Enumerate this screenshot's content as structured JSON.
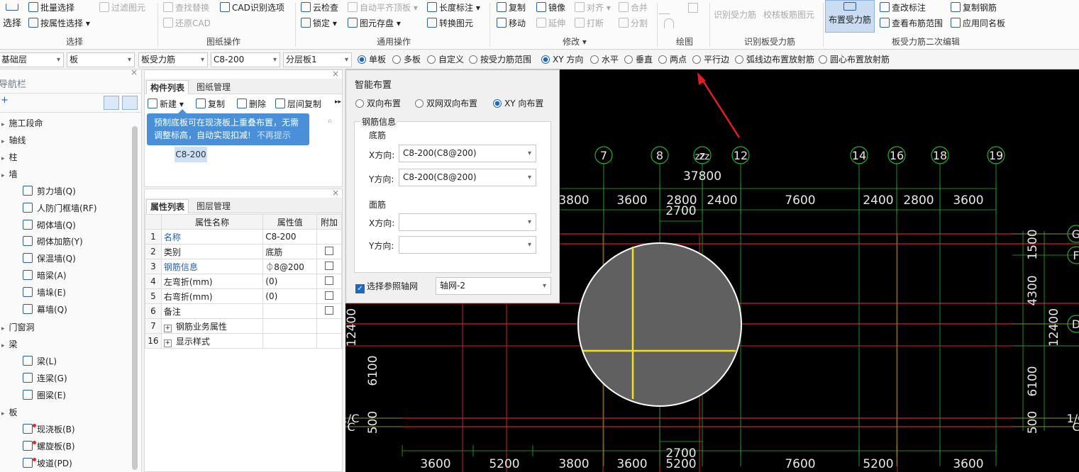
{
  "ribbon": {
    "select_btn": "选择",
    "batch_select": "批量选择",
    "by_attr_select": "按属性选择",
    "filter_element": "过滤图元",
    "find_replace": "查找替换",
    "cad_recognize_options": "CAD识别选项",
    "restore_cad": "还原CAD",
    "cloud_check": "云检查",
    "auto_align_slab": "自动平齐顶板",
    "length_dim": "长度标注",
    "lock": "锁定",
    "element_save": "图元存盘",
    "convert_element": "转换图元",
    "copy": "复制",
    "mirror": "镜像",
    "align": "对齐",
    "merge": "合并",
    "move": "移动",
    "extend": "延伸",
    "break": "打断",
    "split": "分割",
    "recognize_rebar": "识别受力筋",
    "verify_slab": "校核板筋图元",
    "place_rebar": "布置受力筋",
    "check_label": "查改标注",
    "view_range": "查看布筋范围",
    "copy_rebar": "复制钢筋",
    "apply_same_name": "应用同名板",
    "groups": {
      "select": "选择",
      "drawing_ops": "图纸操作",
      "common_ops": "通用操作",
      "modify": "修改",
      "draw": "绘图",
      "recognize": "识别板受力筋",
      "edit2": "板受力筋二次编辑"
    }
  },
  "options_bar": {
    "floor": "基础层",
    "category": "板",
    "type": "板受力筋",
    "element": "C8-200",
    "layer": "分层板1",
    "radios": [
      {
        "label": "单板",
        "checked": true
      },
      {
        "label": "多板",
        "checked": false
      },
      {
        "label": "自定义",
        "checked": false
      },
      {
        "label": "按受力筋范围",
        "checked": false
      },
      {
        "label": "XY 方向",
        "checked": true
      },
      {
        "label": "水平",
        "checked": false
      },
      {
        "label": "垂直",
        "checked": false
      },
      {
        "label": "两点",
        "checked": false
      },
      {
        "label": "平行边",
        "checked": false
      },
      {
        "label": "弧线边布置放射筋",
        "checked": false
      },
      {
        "label": "圆心布置放射筋",
        "checked": false
      }
    ]
  },
  "nav": {
    "title": "导航栏",
    "items": [
      {
        "label": "施工段命",
        "level": 0
      },
      {
        "label": "轴线",
        "level": 0
      },
      {
        "label": "柱",
        "level": 0
      },
      {
        "label": "墙",
        "level": 0
      },
      {
        "label": "剪力墙(Q)",
        "level": 1
      },
      {
        "label": "人防门框墙(RF)",
        "level": 1
      },
      {
        "label": "砌体墙(Q)",
        "level": 1
      },
      {
        "label": "砌体加筋(Y)",
        "level": 1
      },
      {
        "label": "保温墙(Q)",
        "level": 1
      },
      {
        "label": "暗梁(A)",
        "level": 1
      },
      {
        "label": "墙垛(E)",
        "level": 1
      },
      {
        "label": "幕墙(Q)",
        "level": 1
      },
      {
        "label": "门窗洞",
        "level": 0
      },
      {
        "label": "梁",
        "level": 0
      },
      {
        "label": "梁(L)",
        "level": 1
      },
      {
        "label": "连梁(G)",
        "level": 1
      },
      {
        "label": "圈梁(E)",
        "level": 1
      },
      {
        "label": "板",
        "level": 0
      },
      {
        "label": "现浇板(B)",
        "level": 1
      },
      {
        "label": "螺旋板(B)",
        "level": 1
      },
      {
        "label": "坡道(PD)",
        "level": 1
      }
    ]
  },
  "component_pane": {
    "tabs": [
      "构件列表",
      "图纸管理"
    ],
    "new": "新建",
    "copy": "复制",
    "delete": "删除",
    "layer_copy": "层间复制",
    "tip_text": "预制底板可在现浇板上重叠布置，无需调整标高，自动实现扣减!",
    "tip_dismiss": "不再提示",
    "selected_item": "C8-200"
  },
  "property_pane": {
    "tabs": [
      "属性列表",
      "图层管理"
    ],
    "headers": [
      "属性名称",
      "属性值",
      "附加"
    ],
    "rows": [
      {
        "no": "1",
        "name": "名称",
        "value": "C8-200",
        "blue": true,
        "check": false
      },
      {
        "no": "2",
        "name": "类别",
        "value": "底筋",
        "blue": false,
        "check": true
      },
      {
        "no": "3",
        "name": "钢筋信息",
        "value": "⏀8@200",
        "blue": true,
        "check": true
      },
      {
        "no": "4",
        "name": "左弯折(mm)",
        "value": "(0)",
        "blue": false,
        "check": true
      },
      {
        "no": "5",
        "name": "右弯折(mm)",
        "value": "(0)",
        "blue": false,
        "check": true
      },
      {
        "no": "6",
        "name": "备注",
        "value": "",
        "blue": false,
        "check": true
      },
      {
        "no": "7",
        "name": "钢筋业务属性",
        "value": "",
        "blue": false,
        "check": false,
        "expand": true
      },
      {
        "no": "16",
        "name": "显示样式",
        "value": "",
        "blue": false,
        "check": false,
        "expand": true
      }
    ]
  },
  "dialog": {
    "title": "智能布置",
    "modes": [
      {
        "label": "双向布置",
        "checked": false
      },
      {
        "label": "双网双向布置",
        "checked": false
      },
      {
        "label": "XY 向布置",
        "checked": true
      }
    ],
    "rebar_info": "钢筋信息",
    "bottom": "底筋",
    "top": "面筋",
    "x_label": "X方向:",
    "y_label": "Y方向:",
    "bottom_x": "C8-200(C8@200)",
    "bottom_y": "C8-200(C8@200)",
    "top_x": "",
    "top_y": "",
    "ref_axis_label": "选择参照轴网",
    "ref_axis_checked": true,
    "ref_axis_value": "轴网-2"
  },
  "cad": {
    "axis_top": [
      "7",
      "8",
      "z",
      "12",
      "14",
      "16",
      "18",
      "19"
    ],
    "axis_overlap": "zzz",
    "overall_dim": "37800",
    "dims_top": [
      "3800",
      "3600",
      "2800",
      "2400",
      "7600",
      "2400",
      "2800",
      "3600"
    ],
    "dim_2700": "2700",
    "dims_bottom": [
      "3600",
      "5200",
      "3800",
      "3600",
      "5200",
      "7600",
      "5200",
      "3600"
    ],
    "dims_right": [
      "1500",
      "4300",
      "6100",
      "500"
    ],
    "dims_left": [
      "6100",
      "500"
    ],
    "total_side": "12400",
    "axis_right": [
      "G",
      "F",
      "D",
      "1/C",
      "C"
    ],
    "axis_left": [
      "1/C",
      "C"
    ]
  }
}
